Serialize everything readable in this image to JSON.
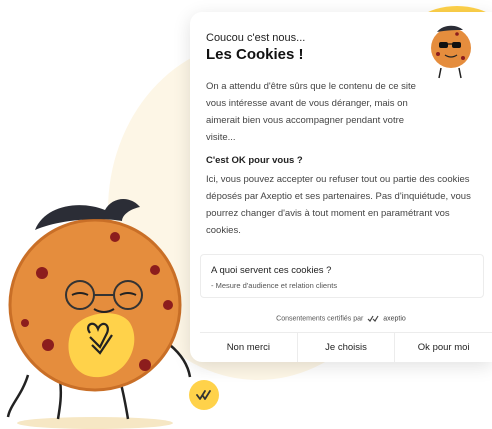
{
  "banner": {
    "greeting": "Coucou c'est nous...",
    "title": "Les Cookies !",
    "intro": "On a attendu d'être sûrs que le contenu de ce site vous intéresse avant de vous déranger, mais on aimerait bien vous accompagner pendant votre visite...",
    "question": "C'est OK pour vous ?",
    "description": "Ici, vous pouvez accepter ou refuser tout ou partie des cookies déposés par Axeptio et ses partenaires. Pas d'inquiétude, vous pourrez changer d'avis à tout moment en paramétrant vos cookies."
  },
  "purpose": {
    "title": "A quoi servent ces cookies ?",
    "item": "- Mesure d'audience et relation clients"
  },
  "certification": {
    "text": "Consentements certifiés par",
    "brand": "axeptio"
  },
  "buttons": {
    "refuse": "Non merci",
    "choose": "Je choisis",
    "accept": "Ok pour moi"
  },
  "colors": {
    "accent": "#ffd24a",
    "cookie": "#e58d3d",
    "chip": "#8c1d1d"
  },
  "icons": {
    "mascot": "cookie-mascot-icon",
    "mini_mascot": "cookie-sunglasses-icon",
    "widget": "axeptio-check-icon"
  }
}
